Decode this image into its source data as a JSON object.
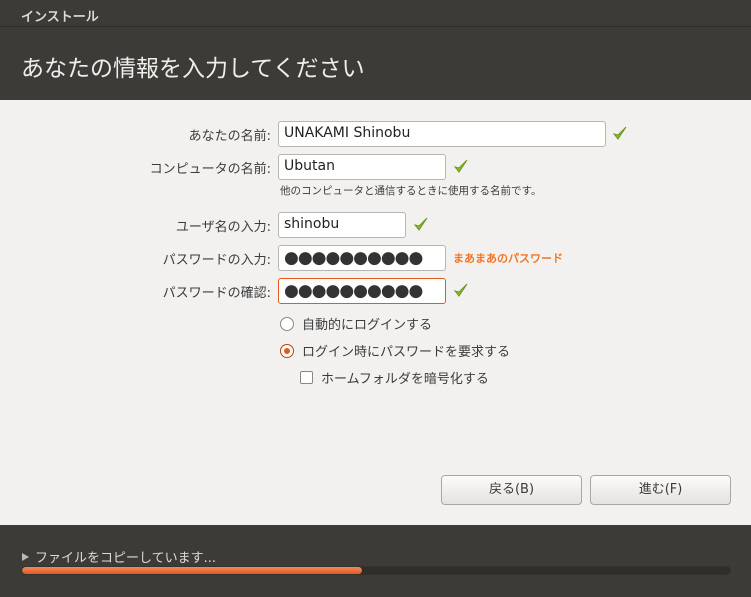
{
  "window": {
    "title": "インストール"
  },
  "header": {
    "title": "あなたの情報を入力してください"
  },
  "form": {
    "name_label": "あなたの名前:",
    "name_value": "UNAKAMI Shinobu",
    "computer_label": "コンピュータの名前:",
    "computer_value": "Ubutan",
    "computer_hint": "他のコンピュータと通信するときに使用する名前です。",
    "username_label": "ユーザ名の入力:",
    "username_value": "shinobu",
    "password_label": "パスワードの入力:",
    "password_value": "●●●●●●●●●●",
    "password_strength": "まあまあのパスワード",
    "confirm_label": "パスワードの確認:",
    "confirm_value": "●●●●●●●●●●",
    "auto_login_label": "自動的にログインする",
    "auto_login_selected": false,
    "require_password_label": "ログイン時にパスワードを要求する",
    "require_password_selected": true,
    "encrypt_home_label": "ホームフォルダを暗号化する",
    "encrypt_home_checked": false
  },
  "buttons": {
    "back": "戻る(B)",
    "forward": "進む(F)"
  },
  "footer": {
    "status": "ファイルをコピーしています...",
    "progress_percent": 48
  },
  "colors": {
    "accent": "#e25a1e",
    "check": "#8ab632",
    "strength": "#f47421"
  }
}
